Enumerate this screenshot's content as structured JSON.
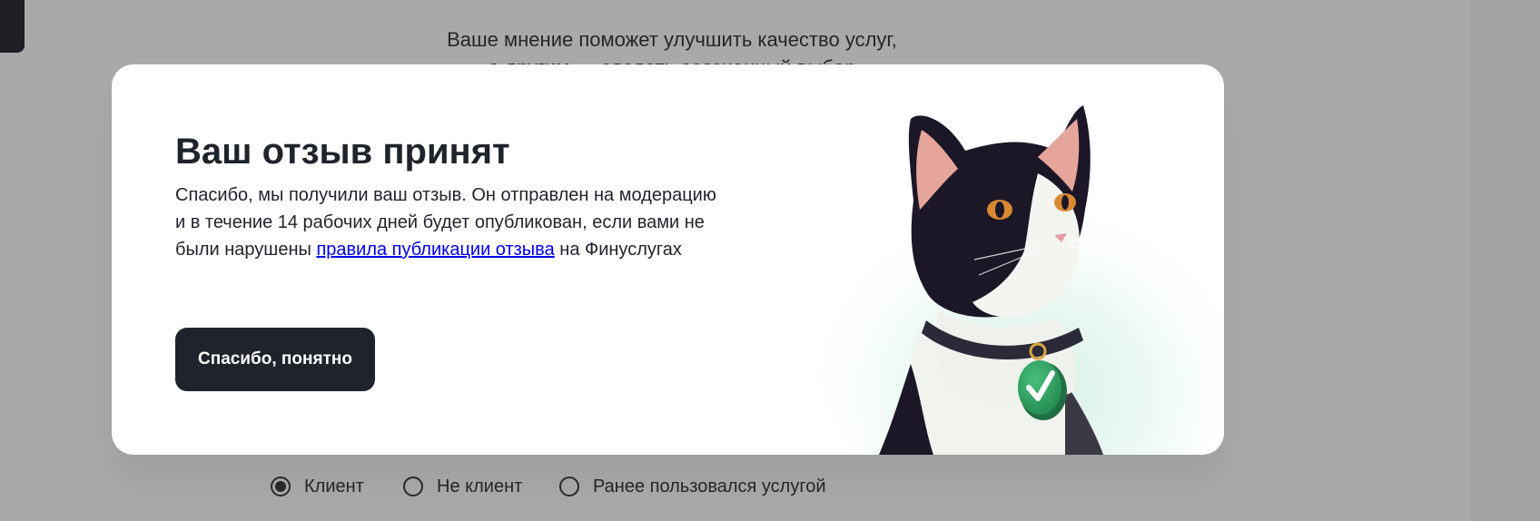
{
  "background": {
    "intro_line1": "Ваше мнение поможет улучшить качество услуг,",
    "intro_line2": "а другим — сделать осознанный выбор"
  },
  "modal": {
    "title": "Ваш отзыв принят",
    "body_before_link": "Спасибо, мы получили ваш отзыв. Он отправлен на модерацию и в течение 14 рабочих дней будет опубликован, если вами не были нарушены ",
    "link_text": "правила публикации отзыва",
    "body_after_link": " на Финуслугах",
    "button_label": "Спасибо, понятно",
    "illustration": "cat-with-check-tag-illustration"
  },
  "client_status": {
    "options": [
      {
        "label": "Клиент",
        "selected": true
      },
      {
        "label": "Не клиент",
        "selected": false
      },
      {
        "label": "Ранее пользовался услугой",
        "selected": false
      }
    ]
  },
  "colors": {
    "overlay": "#a9a9a9",
    "button_bg": "#1f232b",
    "link": "#0000ee",
    "tag_green": "#2fa463"
  }
}
